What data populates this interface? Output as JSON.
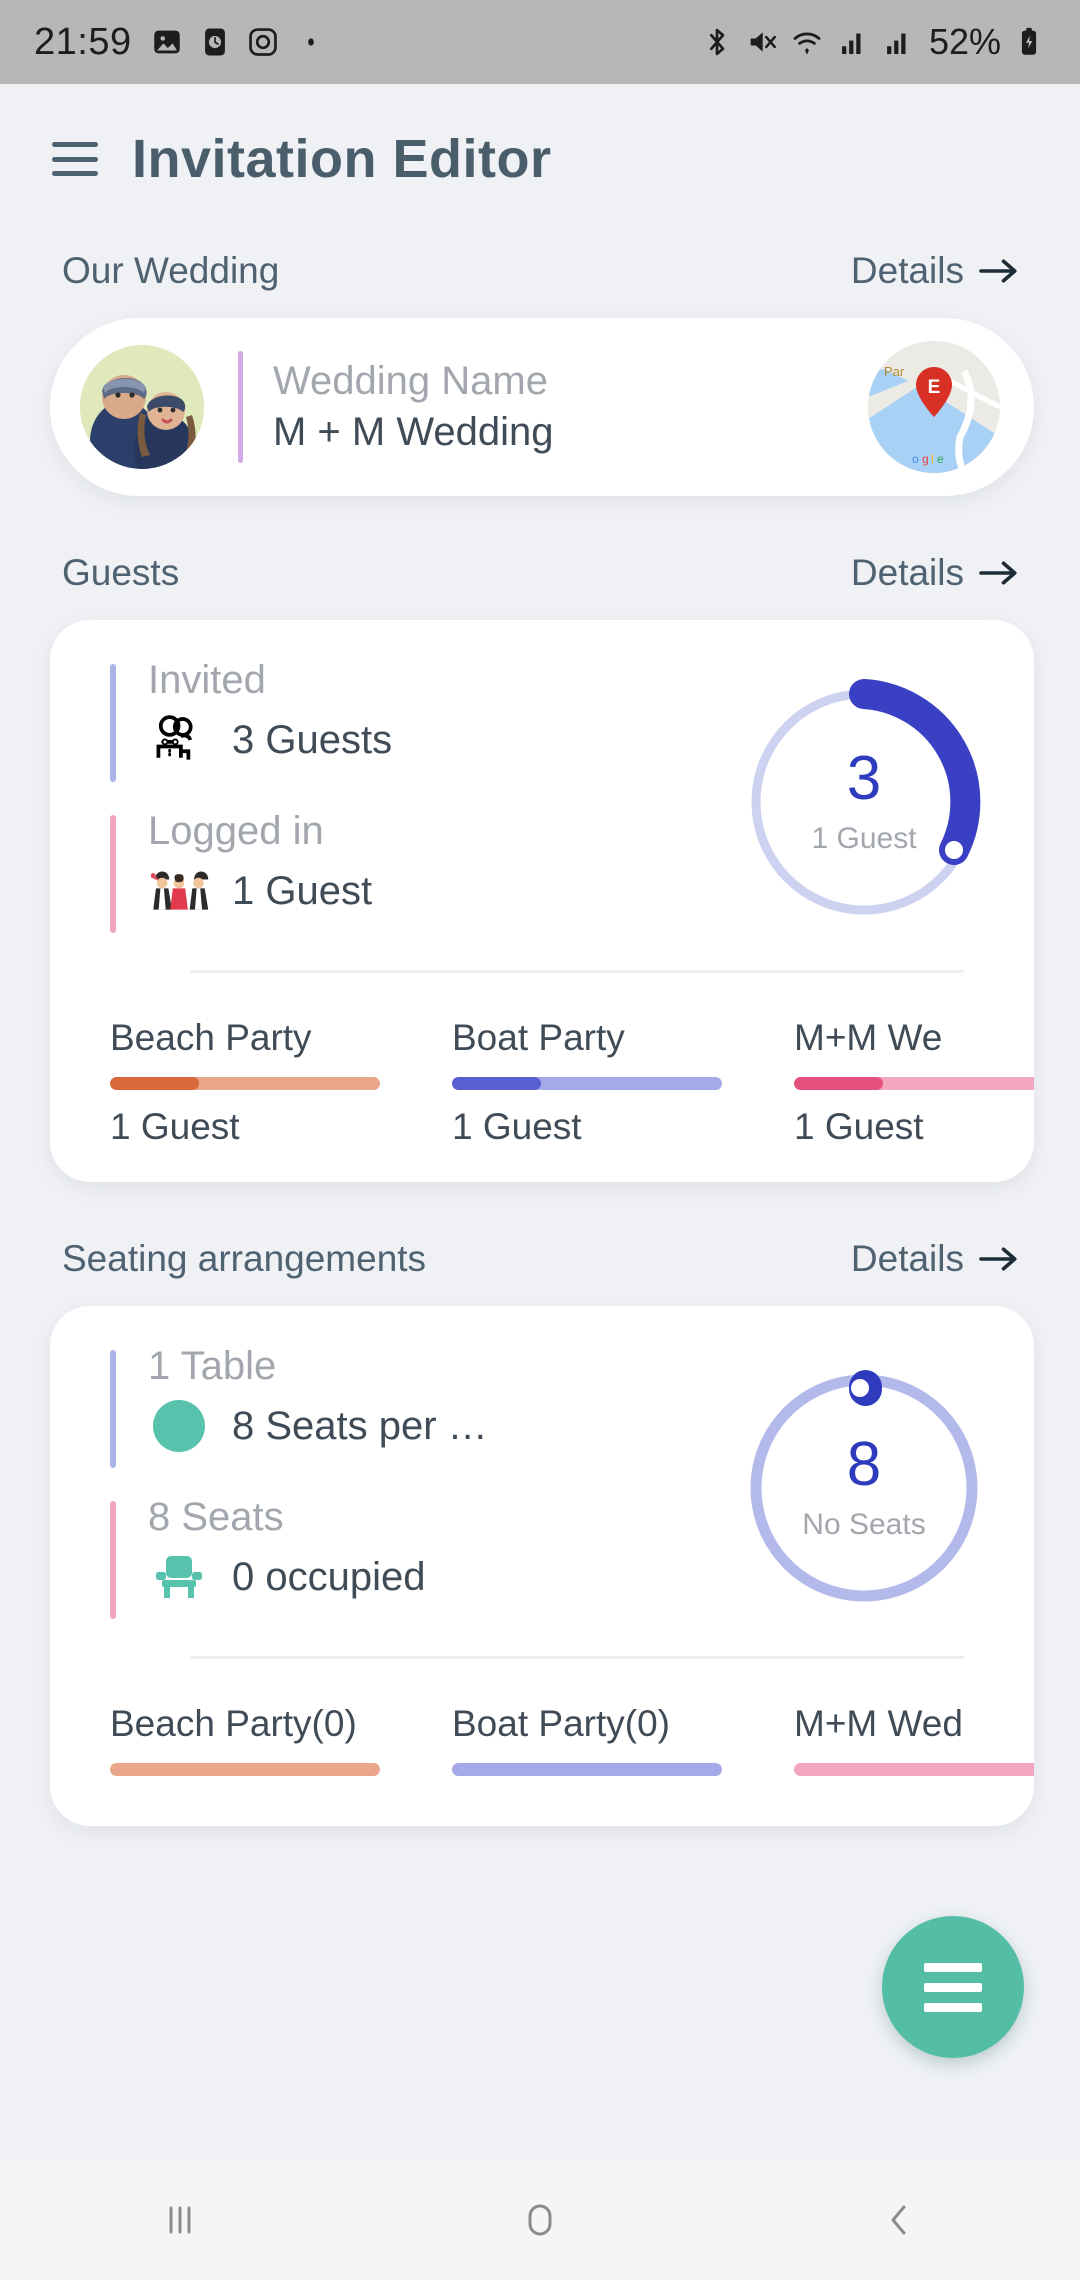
{
  "statusbar": {
    "time": "21:59",
    "battery_percent": "52%",
    "left_icons": [
      "photo-icon",
      "clock-icon",
      "instagram-icon",
      "dot-icon"
    ],
    "right_icons": [
      "bluetooth-icon",
      "mute-icon",
      "wifi-icon",
      "signal-icon",
      "signal-icon-2",
      "battery-charging-icon"
    ]
  },
  "appbar": {
    "menu_icon": "hamburger-icon",
    "title": "Invitation Editor"
  },
  "sections": {
    "wedding": {
      "title": "Our Wedding",
      "details_label": "Details",
      "card": {
        "avatar": "couple-photo",
        "label": "Wedding Name",
        "value": "M + M Wedding",
        "map": "map-thumbnail",
        "map_pin_letter": "E"
      }
    },
    "guests": {
      "title": "Guests",
      "details_label": "Details",
      "stats": [
        {
          "label": "Invited",
          "icon": "people-icon",
          "value": "3 Guests",
          "bar_color": "#aab4e8"
        },
        {
          "label": "Logged in",
          "icon": "wedding-party-icon",
          "value": "1 Guest",
          "bar_color": "#f0a7bb"
        }
      ],
      "gauge": {
        "number": "3",
        "caption": "1 Guest",
        "progress": 0.33,
        "track_color": "#cdd2f0",
        "fill_color": "#3a40c4"
      },
      "legend": [
        {
          "name": "Beach Party",
          "sub": "1 Guest",
          "fill": "#d9693a",
          "track": "#e9a68b",
          "progress": 0.33
        },
        {
          "name": "Boat Party",
          "sub": "1 Guest",
          "fill": "#5a5fd0",
          "track": "#a6a9e8",
          "progress": 0.33
        },
        {
          "name": "M+M We",
          "sub": "1 Guest",
          "fill": "#e5517e",
          "track": "#f3a7be",
          "progress": 0.33
        }
      ]
    },
    "seating": {
      "title": "Seating arrangements",
      "details_label": "Details",
      "stats": [
        {
          "label": "1 Table",
          "icon": "circle-icon",
          "value": "8 Seats per …",
          "bar_color": "#aab4e8"
        },
        {
          "label": "8 Seats",
          "icon": "chair-icon",
          "value": "0 occupied",
          "bar_color": "#f0a7bb"
        }
      ],
      "gauge": {
        "number": "8",
        "caption": "No Seats",
        "progress": 0.0,
        "track_color": "#b3b9ea",
        "fill_color": "#2e3bbd"
      },
      "legend": [
        {
          "name": "Beach Party(0)",
          "sub": "",
          "fill": "#e9a68b",
          "track": "#e9a68b",
          "progress": 0
        },
        {
          "name": "Boat Party(0)",
          "sub": "",
          "fill": "#a6a9e8",
          "track": "#a6a9e8",
          "progress": 0
        },
        {
          "name": "M+M Wed",
          "sub": "",
          "fill": "#f3a7be",
          "track": "#f3a7be",
          "progress": 0
        }
      ]
    }
  },
  "fab": {
    "icon": "menu-icon"
  },
  "navbar": {
    "recents": "recents-icon",
    "home": "home-icon",
    "back": "back-icon"
  },
  "colors": {
    "background": "#eff1f5",
    "card": "#ffffff",
    "text_primary": "#3f4b57",
    "text_muted": "#a2a6ad",
    "accent_blue": "#2e3bbd",
    "accent_teal": "#53bda5"
  }
}
